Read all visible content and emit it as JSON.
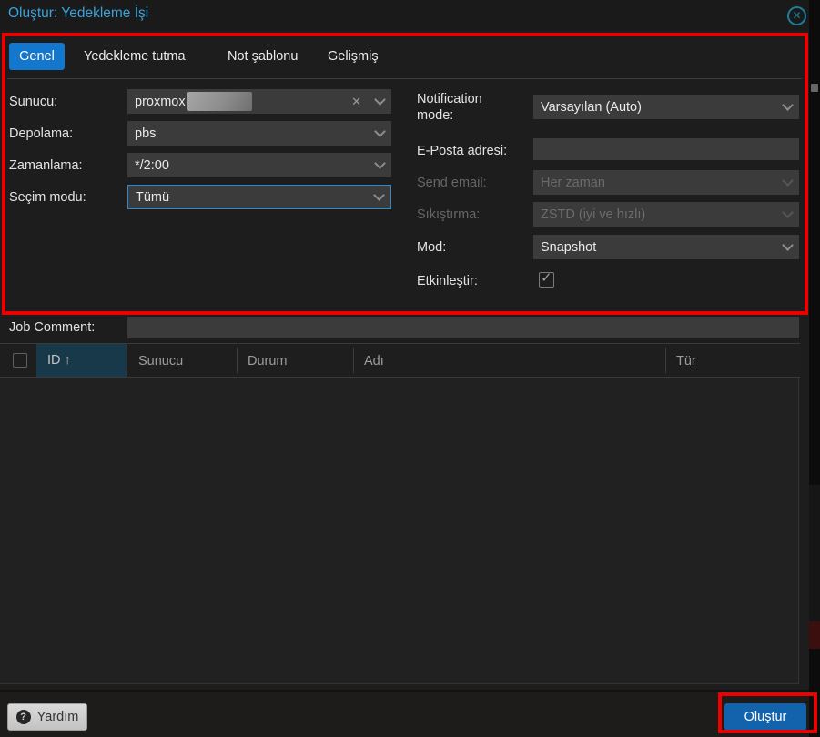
{
  "dialog": {
    "title": "Oluştur: Yedekleme İşi"
  },
  "tabs": [
    {
      "label": "Genel",
      "active": true
    },
    {
      "label": "Yedekleme tutma",
      "active": false
    },
    {
      "label": "Not şablonu",
      "active": false
    },
    {
      "label": "Gelişmiş",
      "active": false
    }
  ],
  "form": {
    "left": [
      {
        "label": "Sunucu:",
        "value": "proxmox",
        "redacted": true,
        "clearable": true
      },
      {
        "label": "Depolama:",
        "value": "pbs"
      },
      {
        "label": "Zamanlama:",
        "value": "*/2:00"
      },
      {
        "label": "Seçim modu:",
        "value": "Tümü",
        "focused": true
      }
    ],
    "right": [
      {
        "label": "Notification mode:",
        "value": "Varsayılan (Auto)"
      },
      {
        "label": "E-Posta adresi:",
        "value": ""
      },
      {
        "label": "Send email:",
        "value": "Her zaman",
        "disabled": true
      },
      {
        "label": "Sıkıştırma:",
        "value": "ZSTD (iyi ve hızlı)",
        "disabled": true
      },
      {
        "label": "Mod:",
        "value": "Snapshot"
      },
      {
        "label": "Etkinleştir:",
        "checked": true
      }
    ],
    "job_comment": {
      "label": "Job Comment:",
      "value": ""
    }
  },
  "table": {
    "columns": [
      {
        "label": "ID",
        "sorted": "asc"
      },
      {
        "label": "Sunucu"
      },
      {
        "label": "Durum"
      },
      {
        "label": "Adı"
      },
      {
        "label": "Tür"
      }
    ],
    "rows": []
  },
  "footer": {
    "help_label": "Yardım",
    "submit_label": "Oluştur"
  },
  "icons": {
    "close": "✕",
    "clear": "✕",
    "help": "?",
    "check": "✓",
    "sort_asc": "↑"
  },
  "colors": {
    "accent_blue": "#1378cd",
    "title_blue": "#38a3dd",
    "button_blue": "#1263ab",
    "annotation_red": "#ee0000",
    "field_bg": "#3b3b3b",
    "sorted_header_bg": "#18394a",
    "close_icon_teal": "#1d7d9c"
  }
}
